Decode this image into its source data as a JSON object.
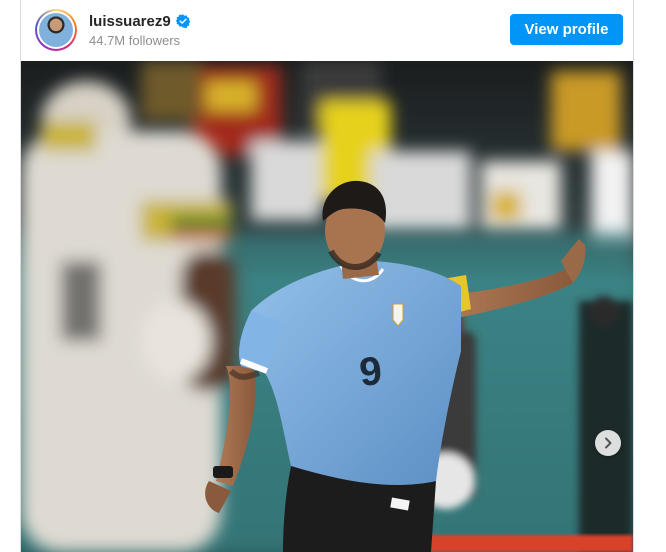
{
  "post": {
    "username": "luissuarez9",
    "followers": "44.7M followers",
    "view_profile_label": "View profile",
    "verified": true,
    "avatar_icon": "profile-avatar",
    "next_icon": "chevron-right-icon"
  },
  "colors": {
    "accent": "#0095f6",
    "verified": "#0095f6",
    "jersey": "#7aaee0",
    "shorts": "#1c1c1c"
  }
}
